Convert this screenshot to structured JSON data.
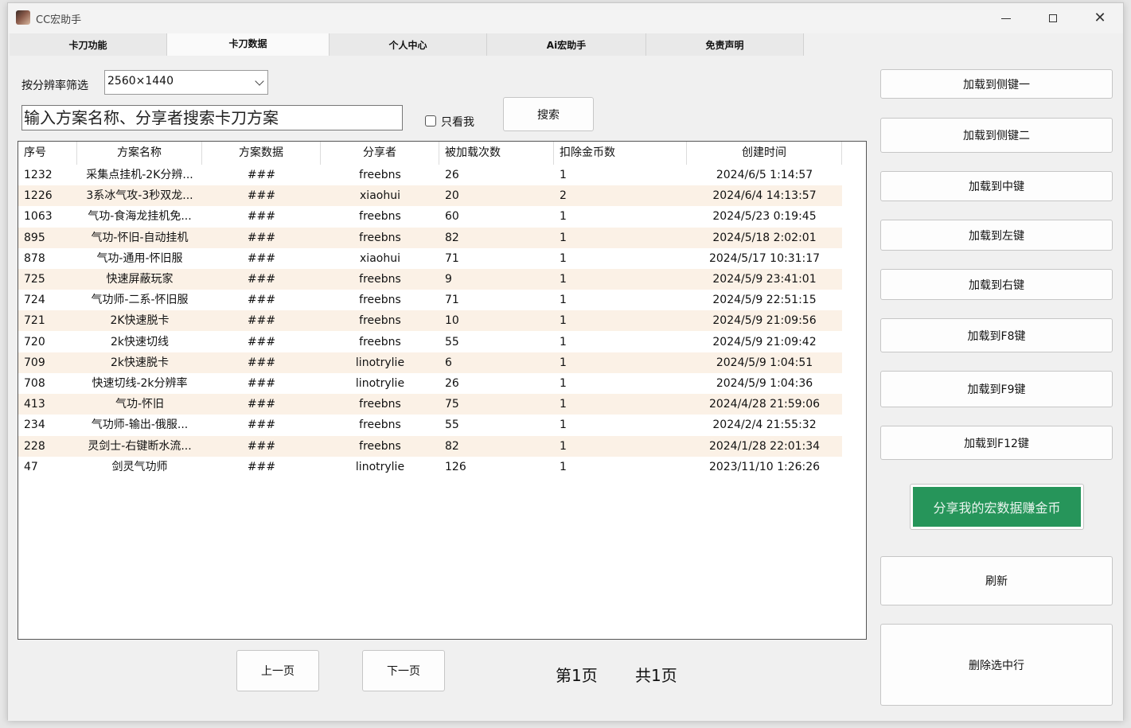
{
  "window": {
    "title": "CC宏助手"
  },
  "tabs": [
    {
      "label": "卡刀功能"
    },
    {
      "label": "卡刀数据"
    },
    {
      "label": "个人中心"
    },
    {
      "label": "Ai宏助手"
    },
    {
      "label": "免责声明"
    }
  ],
  "filter": {
    "resolution_label": "按分辨率筛选",
    "resolution_value": "2560×1440",
    "search_placeholder": "输入方案名称、分享者搜索卡刀方案",
    "only_me_label": "只看我",
    "only_me_checked": false,
    "search_button": "搜索"
  },
  "table": {
    "columns": [
      "序号",
      "方案名称",
      "方案数据",
      "分享者",
      "被加载次数",
      "扣除金币数",
      "创建时间"
    ],
    "rows": [
      [
        "1232",
        "采集点挂机-2K分辨...",
        "###",
        "freebns",
        "26",
        "1",
        "2024/6/5 1:14:57"
      ],
      [
        "1226",
        "3系冰气攻-3秒双龙...",
        "###",
        "xiaohui",
        "20",
        "2",
        "2024/6/4 14:13:57"
      ],
      [
        "1063",
        "气功-食海龙挂机免...",
        "###",
        "freebns",
        "60",
        "1",
        "2024/5/23 0:19:45"
      ],
      [
        "895",
        "气功-怀旧-自动挂机",
        "###",
        "freebns",
        "82",
        "1",
        "2024/5/18 2:02:01"
      ],
      [
        "878",
        "气功-通用-怀旧服",
        "###",
        "xiaohui",
        "71",
        "1",
        "2024/5/17 10:31:17"
      ],
      [
        "725",
        "快速屏蔽玩家",
        "###",
        "freebns",
        "9",
        "1",
        "2024/5/9 23:41:01"
      ],
      [
        "724",
        "气功师-二系-怀旧服",
        "###",
        "freebns",
        "71",
        "1",
        "2024/5/9 22:51:15"
      ],
      [
        "721",
        "2K快速脱卡",
        "###",
        "freebns",
        "10",
        "1",
        "2024/5/9 21:09:56"
      ],
      [
        "720",
        "2k快速切线",
        "###",
        "freebns",
        "55",
        "1",
        "2024/5/9 21:09:42"
      ],
      [
        "709",
        "2k快速脱卡",
        "###",
        "linotrylie",
        "6",
        "1",
        "2024/5/9 1:04:51"
      ],
      [
        "708",
        "快速切线-2k分辨率",
        "###",
        "linotrylie",
        "26",
        "1",
        "2024/5/9 1:04:36"
      ],
      [
        "413",
        "气功-怀旧",
        "###",
        "freebns",
        "75",
        "1",
        "2024/4/28 21:59:06"
      ],
      [
        "234",
        "气功师-输出-俄服...",
        "###",
        "freebns",
        "55",
        "1",
        "2024/2/4 21:55:32"
      ],
      [
        "228",
        "灵剑士-右键断水流...",
        "###",
        "freebns",
        "82",
        "1",
        "2024/1/28 22:01:34"
      ],
      [
        "47",
        "剑灵气功师",
        "###",
        "linotrylie",
        "126",
        "1",
        "2023/11/10 1:26:26"
      ]
    ]
  },
  "pager": {
    "prev": "上一页",
    "next": "下一页",
    "current": "第1页",
    "total": "共1页"
  },
  "actions": {
    "side1": "加载到侧键一",
    "side2": "加载到侧键二",
    "middle": "加载到中键",
    "left": "加载到左键",
    "right": "加载到右键",
    "f8": "加载到F8键",
    "f9": "加载到F9键",
    "f12": "加载到F12键",
    "share": "分享我的宏数据赚金币",
    "refresh": "刷新",
    "delete": "删除选中行"
  },
  "colors": {
    "share_button": "#26955a",
    "row_alt": "#fbf1e6"
  }
}
